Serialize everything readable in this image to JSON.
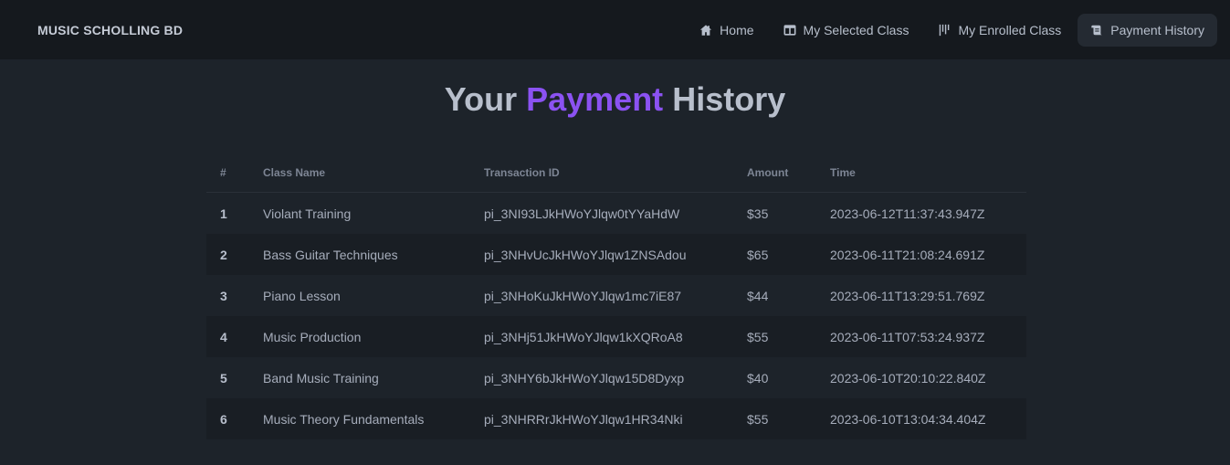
{
  "navbar": {
    "brand": "MUSIC SCHOLLING BD",
    "links": [
      {
        "label": "Home",
        "icon": "home-icon"
      },
      {
        "label": "My Selected Class",
        "icon": "columns-icon"
      },
      {
        "label": "My Enrolled Class",
        "icon": "bars-icon"
      },
      {
        "label": "Payment History",
        "icon": "scroll-icon",
        "active": true
      }
    ]
  },
  "title": {
    "part1": "Your ",
    "accent": "Payment",
    "part2": " History"
  },
  "table": {
    "headers": [
      "#",
      "Class Name",
      "Transaction ID",
      "Amount",
      "Time"
    ],
    "rows": [
      {
        "index": "1",
        "class_name": "Violant Training",
        "transaction_id": "pi_3NI93LJkHWoYJlqw0tYYaHdW",
        "amount": "$35",
        "time": "2023-06-12T11:37:43.947Z"
      },
      {
        "index": "2",
        "class_name": "Bass Guitar Techniques",
        "transaction_id": "pi_3NHvUcJkHWoYJlqw1ZNSAdou",
        "amount": "$65",
        "time": "2023-06-11T21:08:24.691Z"
      },
      {
        "index": "3",
        "class_name": "Piano Lesson",
        "transaction_id": "pi_3NHoKuJkHWoYJlqw1mc7iE87",
        "amount": "$44",
        "time": "2023-06-11T13:29:51.769Z"
      },
      {
        "index": "4",
        "class_name": "Music Production",
        "transaction_id": "pi_3NHj51JkHWoYJlqw1kXQRoA8",
        "amount": "$55",
        "time": "2023-06-11T07:53:24.937Z"
      },
      {
        "index": "5",
        "class_name": "Band Music Training",
        "transaction_id": "pi_3NHY6bJkHWoYJlqw15D8Dyxp",
        "amount": "$40",
        "time": "2023-06-10T20:10:22.840Z"
      },
      {
        "index": "6",
        "class_name": "Music Theory Fundamentals",
        "transaction_id": "pi_3NHRRrJkHWoYJlqw1HR34Nki",
        "amount": "$55",
        "time": "2023-06-10T13:04:34.404Z"
      }
    ]
  },
  "colors": {
    "accent": "#8b52f2",
    "background": "#1d232a",
    "navbar": "#15191e"
  }
}
